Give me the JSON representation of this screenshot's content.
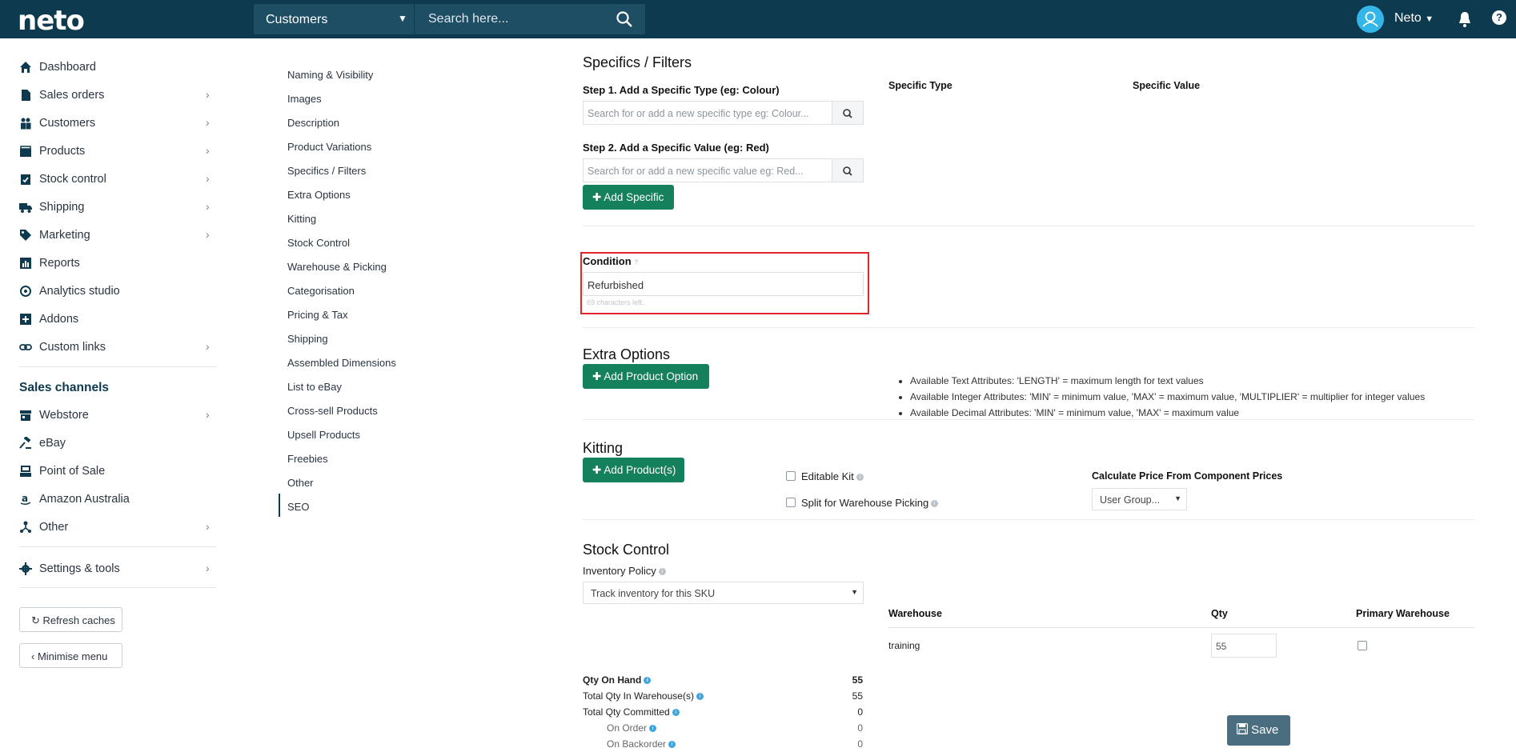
{
  "topbar": {
    "logo": "neto",
    "search_scope": "Customers",
    "search_placeholder": "Search here...",
    "user_name": "Neto",
    "help_label": "?"
  },
  "sidebar": {
    "items": [
      {
        "label": "Dashboard",
        "icon": "home-icon",
        "chevron": false
      },
      {
        "label": "Sales orders",
        "icon": "document-icon",
        "chevron": true
      },
      {
        "label": "Customers",
        "icon": "users-icon",
        "chevron": true
      },
      {
        "label": "Products",
        "icon": "box-icon",
        "chevron": true
      },
      {
        "label": "Stock control",
        "icon": "clipboard-check-icon",
        "chevron": true
      },
      {
        "label": "Shipping",
        "icon": "truck-icon",
        "chevron": true
      },
      {
        "label": "Marketing",
        "icon": "tag-icon",
        "chevron": true
      },
      {
        "label": "Reports",
        "icon": "bar-chart-icon",
        "chevron": false
      },
      {
        "label": "Analytics studio",
        "icon": "gear-analytics-icon",
        "chevron": false
      },
      {
        "label": "Addons",
        "icon": "plus-square-icon",
        "chevron": false
      },
      {
        "label": "Custom links",
        "icon": "link-icon",
        "chevron": true
      }
    ],
    "sales_channels_heading": "Sales channels",
    "channels": [
      {
        "label": "Webstore",
        "icon": "store-icon",
        "chevron": true
      },
      {
        "label": "eBay",
        "icon": "gavel-icon",
        "chevron": false
      },
      {
        "label": "Point of Sale",
        "icon": "pos-icon",
        "chevron": false
      },
      {
        "label": "Amazon Australia",
        "icon": "amazon-icon",
        "chevron": false
      },
      {
        "label": "Other",
        "icon": "sitemap-icon",
        "chevron": true
      }
    ],
    "settings": {
      "label": "Settings & tools",
      "icon": "gear-icon"
    },
    "refresh_label": "Refresh caches",
    "minimise_label": "Minimise menu"
  },
  "subnav": {
    "items": [
      "Naming & Visibility",
      "Images",
      "Description",
      "Product Variations",
      "Specifics / Filters",
      "Extra Options",
      "Kitting",
      "Stock Control",
      "Warehouse & Picking",
      "Categorisation",
      "Pricing & Tax",
      "Shipping",
      "Assembled Dimensions",
      "List to eBay",
      "Cross-sell Products",
      "Upsell Products",
      "Freebies",
      "Other",
      "SEO"
    ],
    "active": "SEO"
  },
  "specifics": {
    "title": "Specifics / Filters",
    "step1_label": "Step 1. Add a Specific Type (eg: Colour)",
    "step1_placeholder": "Search for or add a new specific type eg: Colour...",
    "step2_label": "Step 2. Add a Specific Value (eg: Red)",
    "step2_placeholder": "Search for or add a new specific value eg: Red...",
    "add_button": "Add Specific",
    "col_type": "Specific Type",
    "col_value": "Specific Value"
  },
  "condition": {
    "label": "Condition",
    "value": "Refurbished",
    "chars_left": "69 characters left."
  },
  "extra_options": {
    "title": "Extra Options",
    "add_button": "Add Product Option",
    "notes": [
      "Available Text Attributes: 'LENGTH' = maximum length for text values",
      "Available Integer Attributes: 'MIN' = minimum value, 'MAX' = maximum value, 'MULTIPLIER' = multiplier for integer values",
      "Available Decimal Attributes: 'MIN' = minimum value, 'MAX' = maximum value"
    ]
  },
  "kitting": {
    "title": "Kitting",
    "add_button": "Add Product(s)",
    "editable_kit": "Editable Kit",
    "split_picking": "Split for Warehouse Picking",
    "calc_label": "Calculate Price From Component Prices",
    "calc_select": "User Group..."
  },
  "stock": {
    "title": "Stock Control",
    "policy_label": "Inventory Policy",
    "policy_value": "Track inventory for this SKU",
    "col_warehouse": "Warehouse",
    "col_qty": "Qty",
    "col_primary": "Primary Warehouse",
    "warehouse_name": "training",
    "warehouse_qty": "55",
    "rows": [
      {
        "label": "Qty On Hand",
        "value": "55"
      },
      {
        "label": "Total Qty In Warehouse(s)",
        "value": "55"
      },
      {
        "label": "Total Qty Committed",
        "value": "0"
      },
      {
        "label": "On Order",
        "value": "0"
      },
      {
        "label": "On Backorder",
        "value": "0"
      }
    ]
  },
  "save_label": "Save",
  "colors": {
    "topbar": "#0e3a4f",
    "accent_green": "#15805c",
    "highlight_red": "#e0252b",
    "save_button": "#4a6d80"
  }
}
